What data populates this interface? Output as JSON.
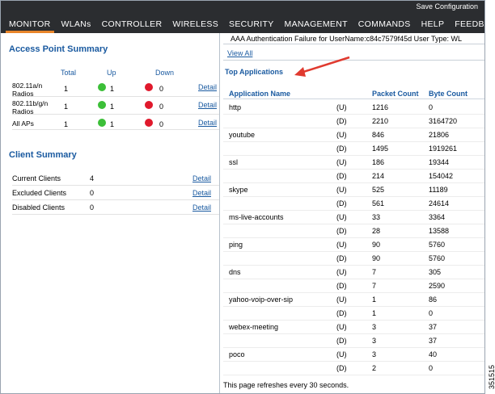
{
  "header": {
    "save_link": "Save Configuration",
    "nav": [
      {
        "label": "MONITOR",
        "active": true
      },
      {
        "label": "WLANs",
        "active": false
      },
      {
        "label": "CONTROLLER",
        "active": false
      },
      {
        "label": "WIRELESS",
        "active": false
      },
      {
        "label": "SECURITY",
        "active": false
      },
      {
        "label": "MANAGEMENT",
        "active": false
      },
      {
        "label": "COMMANDS",
        "active": false
      },
      {
        "label": "HELP",
        "active": false
      },
      {
        "label": "FEEDBACK",
        "active": false
      }
    ]
  },
  "access_point_summary": {
    "title": "Access Point Summary",
    "columns": {
      "total": "Total",
      "up": "Up",
      "down": "Down"
    },
    "rows": [
      {
        "name": "802.11a/n Radios",
        "total": "1",
        "up": "1",
        "down": "0",
        "detail": "Detail"
      },
      {
        "name": "802.11b/g/n Radios",
        "total": "1",
        "up": "1",
        "down": "0",
        "detail": "Detail"
      },
      {
        "name": "All APs",
        "total": "1",
        "up": "1",
        "down": "0",
        "detail": "Detail"
      }
    ],
    "status_colors": {
      "up": "#3cbf38",
      "down": "#e0192c"
    }
  },
  "client_summary": {
    "title": "Client Summary",
    "rows": [
      {
        "label": "Current Clients",
        "count": "4",
        "detail": "Detail"
      },
      {
        "label": "Excluded Clients",
        "count": "0",
        "detail": "Detail"
      },
      {
        "label": "Disabled Clients",
        "count": "0",
        "detail": "Detail"
      }
    ]
  },
  "alarm_text": "AAA Authentication Failure for UserName:c84c7579f45d  User Type: WL",
  "view_all": "View All",
  "top_applications": {
    "title": "Top Applications",
    "columns": {
      "name": "Application Name",
      "packets": "Packet Count",
      "bytes": "Byte Count"
    },
    "rows": [
      {
        "name": "http",
        "up_pkt": "1216",
        "up_byte": "0",
        "down_pkt": "2210",
        "down_byte": "3164720"
      },
      {
        "name": "youtube",
        "up_pkt": "846",
        "up_byte": "21806",
        "down_pkt": "1495",
        "down_byte": "1919261"
      },
      {
        "name": "ssl",
        "up_pkt": "186",
        "up_byte": "19344",
        "down_pkt": "214",
        "down_byte": "154042"
      },
      {
        "name": "skype",
        "up_pkt": "525",
        "up_byte": "11189",
        "down_pkt": "561",
        "down_byte": "24614"
      },
      {
        "name": "ms-live-accounts",
        "up_pkt": "33",
        "up_byte": "3364",
        "down_pkt": "28",
        "down_byte": "13588"
      },
      {
        "name": "ping",
        "up_pkt": "90",
        "up_byte": "5760",
        "down_pkt": "90",
        "down_byte": "5760"
      },
      {
        "name": "dns",
        "up_pkt": "7",
        "up_byte": "305",
        "down_pkt": "7",
        "down_byte": "2590"
      },
      {
        "name": "yahoo-voip-over-sip",
        "up_pkt": "1",
        "up_byte": "86",
        "down_pkt": "1",
        "down_byte": "0"
      },
      {
        "name": "webex-meeting",
        "up_pkt": "3",
        "up_byte": "37",
        "down_pkt": "3",
        "down_byte": "37"
      },
      {
        "name": "poco",
        "up_pkt": "3",
        "up_byte": "40",
        "down_pkt": "2",
        "down_byte": "0"
      }
    ],
    "dir_up": "(U)",
    "dir_down": "(D)"
  },
  "refresh_note": "This page refreshes every 30 seconds.",
  "figure_id": "351515",
  "colors": {
    "accent": "#e8852a",
    "link": "#1a5aa0",
    "annotation_arrow": "#e03a2f"
  }
}
